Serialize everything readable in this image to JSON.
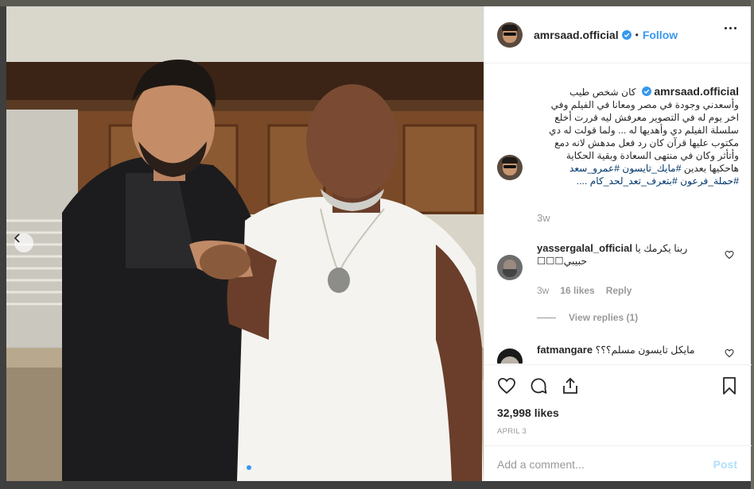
{
  "post": {
    "username": "amrsaad.official",
    "dot": "•",
    "follow_label": "Follow"
  },
  "caption": {
    "username": "amrsaad.official",
    "text": "كان شخص طيب وأسعدني وجودة في مصر ومعانا في الفيلم وفي اخر يوم له في التصوير معرفش ليه قررت أخلع سلسلة الفيلم دي وأهديها له ... ولما قولت له دي مكتوب عليها قرآن كان رد فعل مدهش لانه دمع وأتأثر وكان في منتهى السعادة وبقية الحكاية هاحكيها بعدين",
    "hashtags": "#مايك_تايسون #عمرو_سعد #حملة_فرعون #بتعرف_تعد_لحد_كام ....",
    "age": "3w"
  },
  "comments": [
    {
      "username": "yassergalal_official",
      "text": "ربنا يكرمك يا حبيبي☐☐☐",
      "age": "3w",
      "likes": "16 likes",
      "reply": "Reply",
      "view_replies": "View replies (1)"
    },
    {
      "username": "fatmangare",
      "text": "مايكل تايسون مسلم؟؟؟"
    }
  ],
  "footer": {
    "likes": "32,998 likes",
    "date": "APRIL 3",
    "add_comment_placeholder": "Add a comment...",
    "post_label": "Post"
  },
  "icons": {
    "like": "heart-icon",
    "comment": "comment-bubble-icon",
    "share": "share-icon",
    "save": "bookmark-icon",
    "more": "more-options-icon",
    "verified": "verified-badge-icon",
    "prev": "chevron-left-icon"
  },
  "colors": {
    "link": "#3897f0",
    "hashtag": "#003569",
    "muted": "#999999",
    "post_disabled": "#b2dffc"
  }
}
